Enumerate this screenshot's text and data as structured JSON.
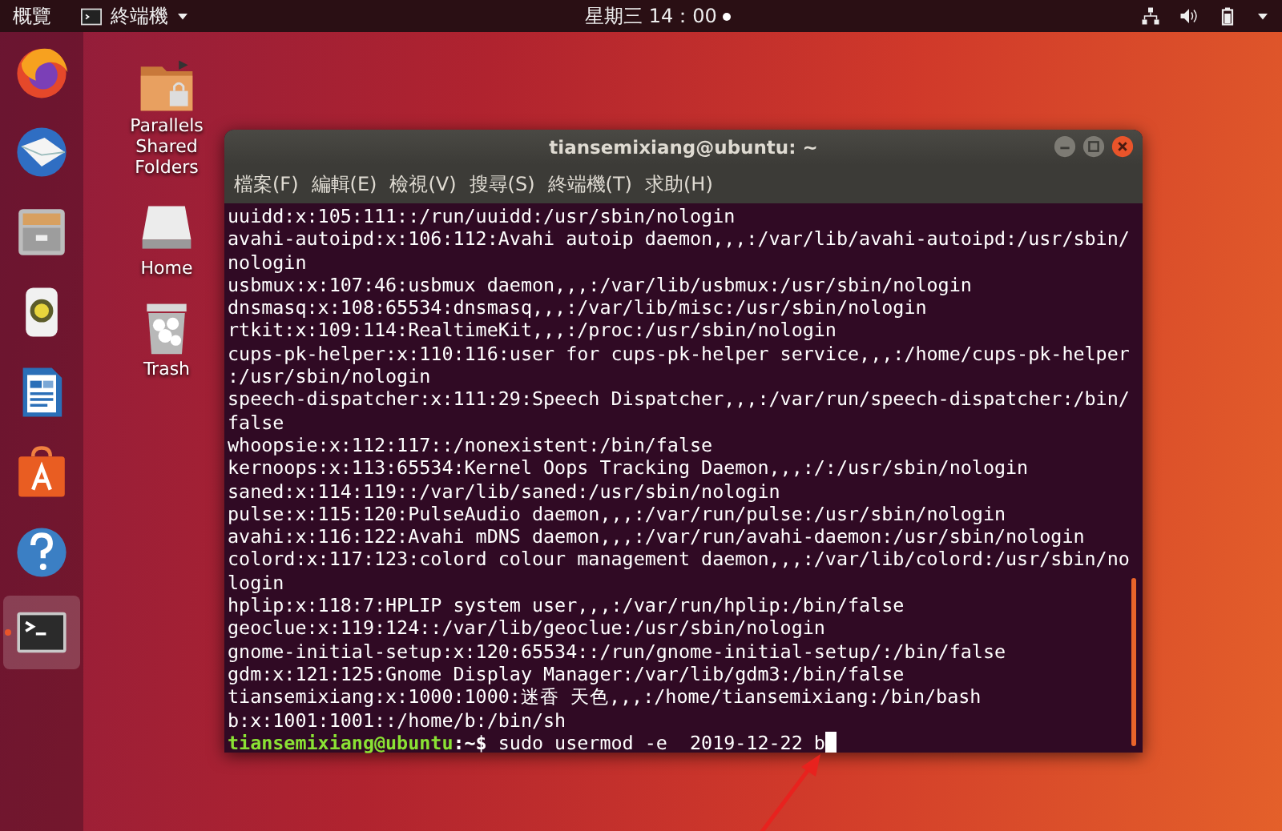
{
  "top_bar": {
    "activities": "概覽",
    "app_menu": "終端機",
    "clock": "星期三 14：00"
  },
  "dock": [
    {
      "kind": "firefox",
      "active": false
    },
    {
      "kind": "mail",
      "active": false
    },
    {
      "kind": "files",
      "active": false
    },
    {
      "kind": "music",
      "active": false
    },
    {
      "kind": "document",
      "active": false
    },
    {
      "kind": "store",
      "active": false
    },
    {
      "kind": "help",
      "active": false
    },
    {
      "kind": "terminal",
      "active": true
    }
  ],
  "desktop_icons": [
    {
      "kind": "shared-folder",
      "label": "Parallels Shared Folders"
    },
    {
      "kind": "drive",
      "label": "Home"
    },
    {
      "kind": "trash",
      "label": "Trash"
    }
  ],
  "window": {
    "title": "tiansemixiang@ubuntu: ~",
    "menu": [
      "檔案(F)",
      "編輯(E)",
      "檢視(V)",
      "搜尋(S)",
      "終端機(T)",
      "求助(H)"
    ],
    "lines": [
      "uuidd:x:105:111::/run/uuidd:/usr/sbin/nologin",
      "avahi-autoipd:x:106:112:Avahi autoip daemon,,,:/var/lib/avahi-autoipd:/usr/sbin/",
      "nologin",
      "usbmux:x:107:46:usbmux daemon,,,:/var/lib/usbmux:/usr/sbin/nologin",
      "dnsmasq:x:108:65534:dnsmasq,,,:/var/lib/misc:/usr/sbin/nologin",
      "rtkit:x:109:114:RealtimeKit,,,:/proc:/usr/sbin/nologin",
      "cups-pk-helper:x:110:116:user for cups-pk-helper service,,,:/home/cups-pk-helper",
      ":/usr/sbin/nologin",
      "speech-dispatcher:x:111:29:Speech Dispatcher,,,:/var/run/speech-dispatcher:/bin/",
      "false",
      "whoopsie:x:112:117::/nonexistent:/bin/false",
      "kernoops:x:113:65534:Kernel Oops Tracking Daemon,,,:/:/usr/sbin/nologin",
      "saned:x:114:119::/var/lib/saned:/usr/sbin/nologin",
      "pulse:x:115:120:PulseAudio daemon,,,:/var/run/pulse:/usr/sbin/nologin",
      "avahi:x:116:122:Avahi mDNS daemon,,,:/var/run/avahi-daemon:/usr/sbin/nologin",
      "colord:x:117:123:colord colour management daemon,,,:/var/lib/colord:/usr/sbin/no",
      "login",
      "hplip:x:118:7:HPLIP system user,,,:/var/run/hplip:/bin/false",
      "geoclue:x:119:124::/var/lib/geoclue:/usr/sbin/nologin",
      "gnome-initial-setup:x:120:65534::/run/gnome-initial-setup/:/bin/false",
      "gdm:x:121:125:Gnome Display Manager:/var/lib/gdm3:/bin/false",
      "tiansemixiang:x:1000:1000:迷香 天色,,,:/home/tiansemixiang:/bin/bash",
      "b:x:1001:1001::/home/b:/bin/sh"
    ],
    "prompt_user": "tiansemixiang@ubuntu",
    "prompt_path": ":~$",
    "command": "sudo usermod -e  2019-12-22 b"
  }
}
